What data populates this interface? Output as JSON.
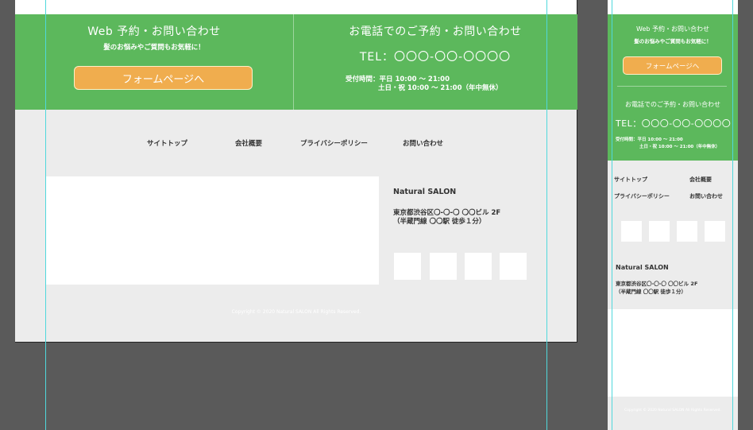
{
  "web_contact": {
    "title": "Web 予約・お問い合わせ",
    "subtitle": "髪のお悩みやご質問もお気軽に！",
    "form_button": "フォームページへ"
  },
  "phone_contact": {
    "title": "お電話でのご予約・お問い合わせ",
    "tel": "TEL：〇〇〇-〇〇-〇〇〇〇",
    "hours_line1": "受付時間：平日 10:00 ～ 21:00",
    "hours_line2": "土日・祝 10:00 ～ 21:00（年中無休）",
    "mobile_hours_line1": "受付時間：平日 10:00 ～ 21:00",
    "mobile_hours_line2": "土日・祝 10:00 ～ 21:00（年中無休）"
  },
  "nav": {
    "items": [
      "サイトトップ",
      "会社概要",
      "プライバシーポリシー",
      "お問い合わせ"
    ]
  },
  "info": {
    "salon_name": "Natural SALON",
    "address_line1": "東京都渋谷区〇-〇-〇 〇〇ビル 2F",
    "address_line2": "（半蔵門線 〇〇駅 徒歩１分）"
  },
  "footer": {
    "copyright": "Copyright © 2020 Natural SALON All Rights Reserved."
  },
  "colors": {
    "green": "#5cb85c",
    "orange": "#f0ad4e",
    "background": "#ececec",
    "canvas": "#5a5a5a",
    "guide": "#4fd8dc"
  }
}
